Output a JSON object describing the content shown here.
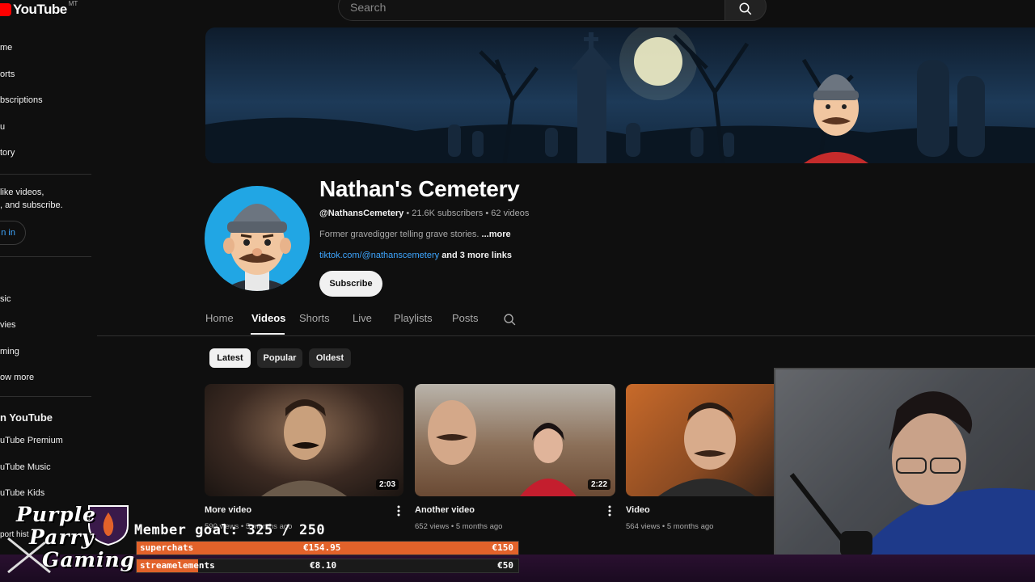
{
  "topbar": {
    "logo_text": "YouTube",
    "logo_region": "MT",
    "search_placeholder": "Search"
  },
  "sidebar": {
    "items": [
      {
        "label": "me"
      },
      {
        "label": "orts"
      },
      {
        "label": "bscriptions"
      },
      {
        "label": "u"
      },
      {
        "label": "tory"
      }
    ],
    "signin_note_line1": "like videos,",
    "signin_note_line2": ", and subscribe.",
    "signin_label": "n in",
    "explore_items": [
      {
        "label": "sic"
      },
      {
        "label": "vies"
      },
      {
        "label": "ming"
      },
      {
        "label": "ow more"
      }
    ],
    "more_heading": "n YouTube",
    "more_items": [
      {
        "label": "uTube Premium"
      },
      {
        "label": "uTube Music"
      },
      {
        "label": "uTube Kids"
      }
    ],
    "report_history": "port hist"
  },
  "channel": {
    "name": "Nathan's Cemetery",
    "handle": "@NathansCemetery",
    "subscribers": "21.6K subscribers",
    "videos_count": "62 videos",
    "description": "Former gravedigger telling grave stories.",
    "more_label": "...more",
    "link": "tiktok.com/@nathanscemetery",
    "more_links": "and 3 more links",
    "subscribe_label": "Subscribe"
  },
  "tabs": [
    {
      "label": "Home",
      "active": false
    },
    {
      "label": "Videos",
      "active": true
    },
    {
      "label": "Shorts",
      "active": false
    },
    {
      "label": "Live",
      "active": false
    },
    {
      "label": "Playlists",
      "active": false
    },
    {
      "label": "Posts",
      "active": false
    }
  ],
  "chips": [
    {
      "label": "Latest",
      "active": true
    },
    {
      "label": "Popular",
      "active": false
    },
    {
      "label": "Oldest",
      "active": false
    }
  ],
  "videos": [
    {
      "title": "More video",
      "meta": "590 views • 5 months ago",
      "duration": "2:03"
    },
    {
      "title": "Another video",
      "meta": "652 views • 5 months ago",
      "duration": "2:22"
    },
    {
      "title": "Video",
      "meta": "564 views • 5 months ago",
      "duration": ""
    }
  ],
  "stream_overlay": {
    "brand_line1": "Purple",
    "brand_line2": "Parry",
    "brand_line3": "Gaming",
    "member_goal": "Member goal: 325 / 250",
    "bars": [
      {
        "label": "superchats",
        "current": "€154.95",
        "target": "€150",
        "progress": 1.0
      },
      {
        "label": "streamelements",
        "current": "€8.10",
        "target": "€50",
        "progress": 0.16
      }
    ]
  },
  "colors": {
    "background": "#0f0f0f",
    "link": "#3ea6ff",
    "brand_red": "#ff0000",
    "goal_orange": "#e2622a"
  }
}
